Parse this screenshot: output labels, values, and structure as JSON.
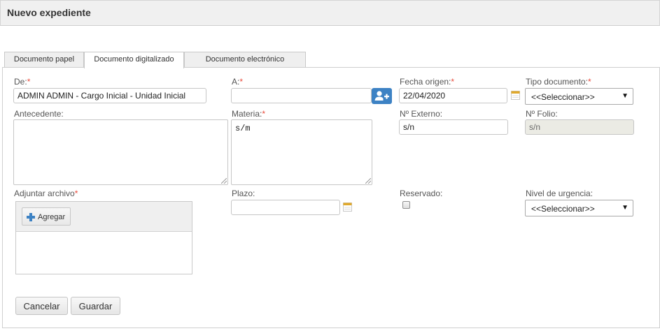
{
  "header": {
    "title": "Nuevo expediente"
  },
  "tabs": [
    {
      "label": "Documento papel"
    },
    {
      "label": "Documento digitalizado"
    },
    {
      "label": "Documento electrónico"
    }
  ],
  "active_tab": "Documento digitalizado",
  "form": {
    "de": {
      "label": "De:",
      "required_mark": "*",
      "value": "ADMIN ADMIN - Cargo Inicial - Unidad Inicial"
    },
    "a": {
      "label": "A:",
      "required_mark": "*",
      "value": ""
    },
    "fecha_origen": {
      "label": "Fecha origen:",
      "required_mark": "*",
      "value": "22/04/2020"
    },
    "tipo_documento": {
      "label": "Tipo documento:",
      "required_mark": "*",
      "selected": "<<Seleccionar>>"
    },
    "antecedente": {
      "label": "Antecedente:",
      "value": ""
    },
    "materia": {
      "label": "Materia:",
      "required_mark": "*",
      "value": "s/m"
    },
    "n_externo": {
      "label": "Nº Externo:",
      "value": "s/n"
    },
    "n_folio": {
      "label": "Nº Folio:",
      "value": "s/n"
    },
    "adjuntar": {
      "label": "Adjuntar archivo",
      "required_mark": "*",
      "add_button": "Agregar"
    },
    "plazo": {
      "label": "Plazo:",
      "value": ""
    },
    "reservado": {
      "label": "Reservado:",
      "checked": false
    },
    "nivel_urgencia": {
      "label": "Nivel de urgencia:",
      "selected": "<<Seleccionar>>"
    }
  },
  "actions": {
    "cancel": "Cancelar",
    "save": "Guardar"
  },
  "colors": {
    "required": "#e84a3b",
    "accent": "#3d82c4",
    "calendar": "#e0a92c"
  },
  "icons": {
    "contact": "add-user-icon",
    "calendar": "calendar-icon",
    "add": "plus-icon",
    "dropdown": "chevron-down-icon"
  }
}
